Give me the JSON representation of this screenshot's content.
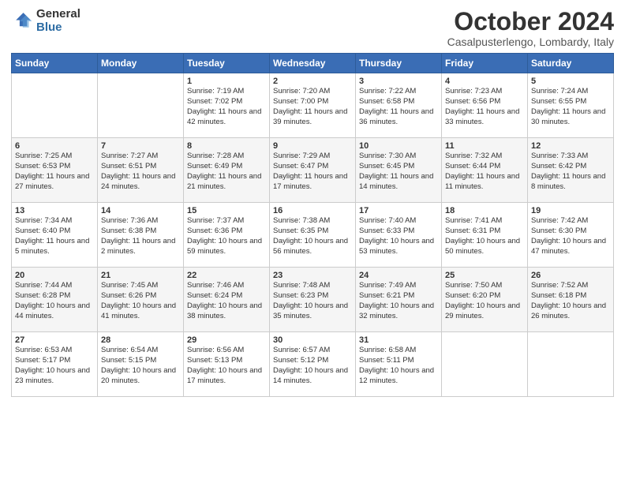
{
  "logo": {
    "general": "General",
    "blue": "Blue"
  },
  "title": "October 2024",
  "location": "Casalpusterlengo, Lombardy, Italy",
  "headers": [
    "Sunday",
    "Monday",
    "Tuesday",
    "Wednesday",
    "Thursday",
    "Friday",
    "Saturday"
  ],
  "weeks": [
    [
      {
        "day": "",
        "info": ""
      },
      {
        "day": "",
        "info": ""
      },
      {
        "day": "1",
        "info": "Sunrise: 7:19 AM\nSunset: 7:02 PM\nDaylight: 11 hours and 42 minutes."
      },
      {
        "day": "2",
        "info": "Sunrise: 7:20 AM\nSunset: 7:00 PM\nDaylight: 11 hours and 39 minutes."
      },
      {
        "day": "3",
        "info": "Sunrise: 7:22 AM\nSunset: 6:58 PM\nDaylight: 11 hours and 36 minutes."
      },
      {
        "day": "4",
        "info": "Sunrise: 7:23 AM\nSunset: 6:56 PM\nDaylight: 11 hours and 33 minutes."
      },
      {
        "day": "5",
        "info": "Sunrise: 7:24 AM\nSunset: 6:55 PM\nDaylight: 11 hours and 30 minutes."
      }
    ],
    [
      {
        "day": "6",
        "info": "Sunrise: 7:25 AM\nSunset: 6:53 PM\nDaylight: 11 hours and 27 minutes."
      },
      {
        "day": "7",
        "info": "Sunrise: 7:27 AM\nSunset: 6:51 PM\nDaylight: 11 hours and 24 minutes."
      },
      {
        "day": "8",
        "info": "Sunrise: 7:28 AM\nSunset: 6:49 PM\nDaylight: 11 hours and 21 minutes."
      },
      {
        "day": "9",
        "info": "Sunrise: 7:29 AM\nSunset: 6:47 PM\nDaylight: 11 hours and 17 minutes."
      },
      {
        "day": "10",
        "info": "Sunrise: 7:30 AM\nSunset: 6:45 PM\nDaylight: 11 hours and 14 minutes."
      },
      {
        "day": "11",
        "info": "Sunrise: 7:32 AM\nSunset: 6:44 PM\nDaylight: 11 hours and 11 minutes."
      },
      {
        "day": "12",
        "info": "Sunrise: 7:33 AM\nSunset: 6:42 PM\nDaylight: 11 hours and 8 minutes."
      }
    ],
    [
      {
        "day": "13",
        "info": "Sunrise: 7:34 AM\nSunset: 6:40 PM\nDaylight: 11 hours and 5 minutes."
      },
      {
        "day": "14",
        "info": "Sunrise: 7:36 AM\nSunset: 6:38 PM\nDaylight: 11 hours and 2 minutes."
      },
      {
        "day": "15",
        "info": "Sunrise: 7:37 AM\nSunset: 6:36 PM\nDaylight: 10 hours and 59 minutes."
      },
      {
        "day": "16",
        "info": "Sunrise: 7:38 AM\nSunset: 6:35 PM\nDaylight: 10 hours and 56 minutes."
      },
      {
        "day": "17",
        "info": "Sunrise: 7:40 AM\nSunset: 6:33 PM\nDaylight: 10 hours and 53 minutes."
      },
      {
        "day": "18",
        "info": "Sunrise: 7:41 AM\nSunset: 6:31 PM\nDaylight: 10 hours and 50 minutes."
      },
      {
        "day": "19",
        "info": "Sunrise: 7:42 AM\nSunset: 6:30 PM\nDaylight: 10 hours and 47 minutes."
      }
    ],
    [
      {
        "day": "20",
        "info": "Sunrise: 7:44 AM\nSunset: 6:28 PM\nDaylight: 10 hours and 44 minutes."
      },
      {
        "day": "21",
        "info": "Sunrise: 7:45 AM\nSunset: 6:26 PM\nDaylight: 10 hours and 41 minutes."
      },
      {
        "day": "22",
        "info": "Sunrise: 7:46 AM\nSunset: 6:24 PM\nDaylight: 10 hours and 38 minutes."
      },
      {
        "day": "23",
        "info": "Sunrise: 7:48 AM\nSunset: 6:23 PM\nDaylight: 10 hours and 35 minutes."
      },
      {
        "day": "24",
        "info": "Sunrise: 7:49 AM\nSunset: 6:21 PM\nDaylight: 10 hours and 32 minutes."
      },
      {
        "day": "25",
        "info": "Sunrise: 7:50 AM\nSunset: 6:20 PM\nDaylight: 10 hours and 29 minutes."
      },
      {
        "day": "26",
        "info": "Sunrise: 7:52 AM\nSunset: 6:18 PM\nDaylight: 10 hours and 26 minutes."
      }
    ],
    [
      {
        "day": "27",
        "info": "Sunrise: 6:53 AM\nSunset: 5:17 PM\nDaylight: 10 hours and 23 minutes."
      },
      {
        "day": "28",
        "info": "Sunrise: 6:54 AM\nSunset: 5:15 PM\nDaylight: 10 hours and 20 minutes."
      },
      {
        "day": "29",
        "info": "Sunrise: 6:56 AM\nSunset: 5:13 PM\nDaylight: 10 hours and 17 minutes."
      },
      {
        "day": "30",
        "info": "Sunrise: 6:57 AM\nSunset: 5:12 PM\nDaylight: 10 hours and 14 minutes."
      },
      {
        "day": "31",
        "info": "Sunrise: 6:58 AM\nSunset: 5:11 PM\nDaylight: 10 hours and 12 minutes."
      },
      {
        "day": "",
        "info": ""
      },
      {
        "day": "",
        "info": ""
      }
    ]
  ]
}
